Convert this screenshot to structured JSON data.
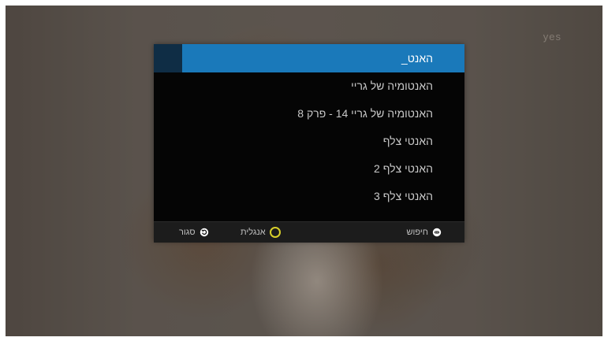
{
  "brand": {
    "text": "yes"
  },
  "search": {
    "query": "האנט_"
  },
  "results": [
    "האנטומיה של גריי",
    "האנטומיה של גריי 14 - פרק 8",
    "האנטי צלף",
    "האנטי צלף 2",
    "האנטי צלף 3"
  ],
  "footer": {
    "close_label": "סגור",
    "english_label": "אנגלית",
    "search_label": "חיפוש",
    "english_color": "#d8cf2a"
  },
  "colors": {
    "highlight": "#1a79ba",
    "dialog_bg": "#050505"
  }
}
